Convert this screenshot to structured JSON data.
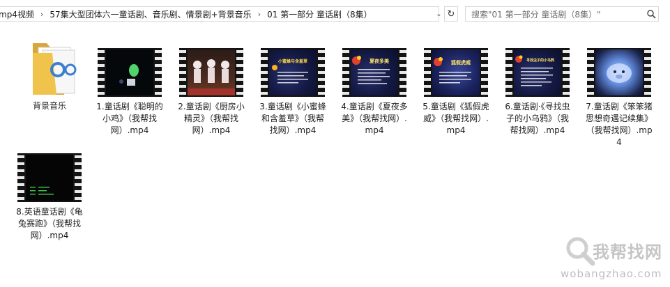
{
  "breadcrumb": [
    "mp4视频",
    "57集大型团体六一童话剧、音乐剧、情景剧+背景音乐",
    "01 第一部分 童话剧（8集）"
  ],
  "search": {
    "placeholder": "搜索\"01 第一部分 童话剧（8集）\""
  },
  "items": [
    {
      "type": "folder",
      "label": "背景音乐"
    },
    {
      "type": "video",
      "scene": "dark",
      "label": "1.童话剧《聪明的小鸡》（我帮找网）.mp4"
    },
    {
      "type": "video",
      "scene": "stage",
      "label": "2.童话剧《厨房小精灵》（我帮找网）.mp4"
    },
    {
      "type": "video",
      "scene": "title",
      "thumb_text": "小蜜蜂与含羞草",
      "label": "3.童话剧《小蜜蜂和含羞草》（我帮找网）.mp4"
    },
    {
      "type": "video",
      "scene": "title",
      "thumb_text": "夏夜多美",
      "label": "4.童话剧《夏夜多美》（我帮找网）.mp4"
    },
    {
      "type": "video",
      "scene": "title2",
      "thumb_text": "狐假虎威",
      "label": "5.童话剧《狐假虎威》（我帮找网）.mp4"
    },
    {
      "type": "video",
      "scene": "title",
      "thumb_text": "寻找虫子的小乌鸦",
      "label": "6.童话剧·《寻找虫子的小乌鸦》（我帮找网）.mp4"
    },
    {
      "type": "video",
      "scene": "blue",
      "label": "7.童话剧《笨笨猪思想奇遇记续集》（我帮找网）.mp4"
    },
    {
      "type": "video",
      "scene": "black",
      "label": "8.英语童话剧《龟兔赛跑》（我帮找网）.mp4"
    }
  ],
  "watermark": {
    "brand": "我帮找网",
    "url": "wobangzhao.com"
  },
  "colors": {
    "folder": "#f0c34d",
    "folder_dark": "#d9a63a",
    "accent_blue": "#3b7fd0"
  }
}
